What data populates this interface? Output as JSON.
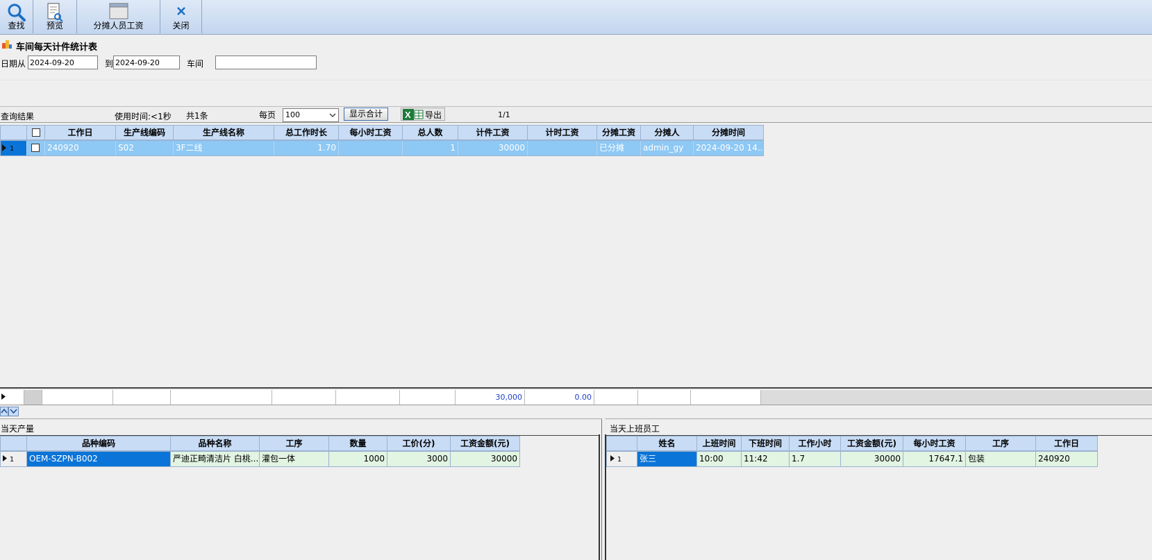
{
  "toolbar": {
    "search": "查找",
    "preview": "预览",
    "allocate": "分摊人员工资",
    "close": "关闭"
  },
  "title": "车间每天计件统计表",
  "filter": {
    "date_from_label": "日期从",
    "date_from": "2024-09-20",
    "date_to_label": "到",
    "date_to": "2024-09-20",
    "workshop_label": "车间",
    "workshop": ""
  },
  "result_bar": {
    "label": "查询结果",
    "time_used": "使用时间:<1秒",
    "total": "共1条",
    "per_page_label": "每页",
    "per_page": "100",
    "show_total": "显示合计",
    "export": "导出",
    "page": "1/1"
  },
  "main_grid": {
    "headers": [
      "工作日",
      "生产线编码",
      "生产线名称",
      "总工作时长",
      "每小时工资",
      "总人数",
      "计件工资",
      "计时工资",
      "分摊工资",
      "分摊人",
      "分摊时间"
    ],
    "row": {
      "index": "1",
      "workday": "240920",
      "line_code": "S02",
      "line_name": "3F二线",
      "total_hours": "1.70",
      "hourly_wage": "",
      "people": "1",
      "piece_wage": "30000",
      "time_wage": "",
      "allocated": "已分摊",
      "allocator": "admin_gy",
      "allocate_time": "2024-09-20 14..."
    },
    "summary": {
      "piece_wage_total": "30,000",
      "time_wage_total": "0.00"
    }
  },
  "output_panel": {
    "title": "当天产量",
    "headers": [
      "品种编码",
      "品种名称",
      "工序",
      "数量",
      "工价(分)",
      "工资金额(元)"
    ],
    "row": {
      "index": "1",
      "code": "OEM-SZPN-B002",
      "name": "严迪正畸清洁片 白桃...",
      "process": "灌包一体",
      "qty": "1000",
      "price": "3000",
      "amount": "30000"
    }
  },
  "staff_panel": {
    "title": "当天上班员工",
    "headers": [
      "姓名",
      "上班时间",
      "下班时间",
      "工作小时",
      "工资金额(元)",
      "每小时工资",
      "工序",
      "工作日"
    ],
    "row": {
      "index": "1",
      "name": "张三",
      "start": "10:00",
      "end": "11:42",
      "hours": "1.7",
      "amount": "30000",
      "hourly": "17647.1",
      "process": "包装",
      "workday": "240920"
    }
  },
  "colors": {
    "toolbar_bg": "#c3d6ef",
    "header_bg": "#c8dcf5",
    "row_selected": "#8ec8f4",
    "cell_selected": "#0a74d8",
    "row_green": "#e2f4e2",
    "summary_text": "#1f3fc8"
  }
}
